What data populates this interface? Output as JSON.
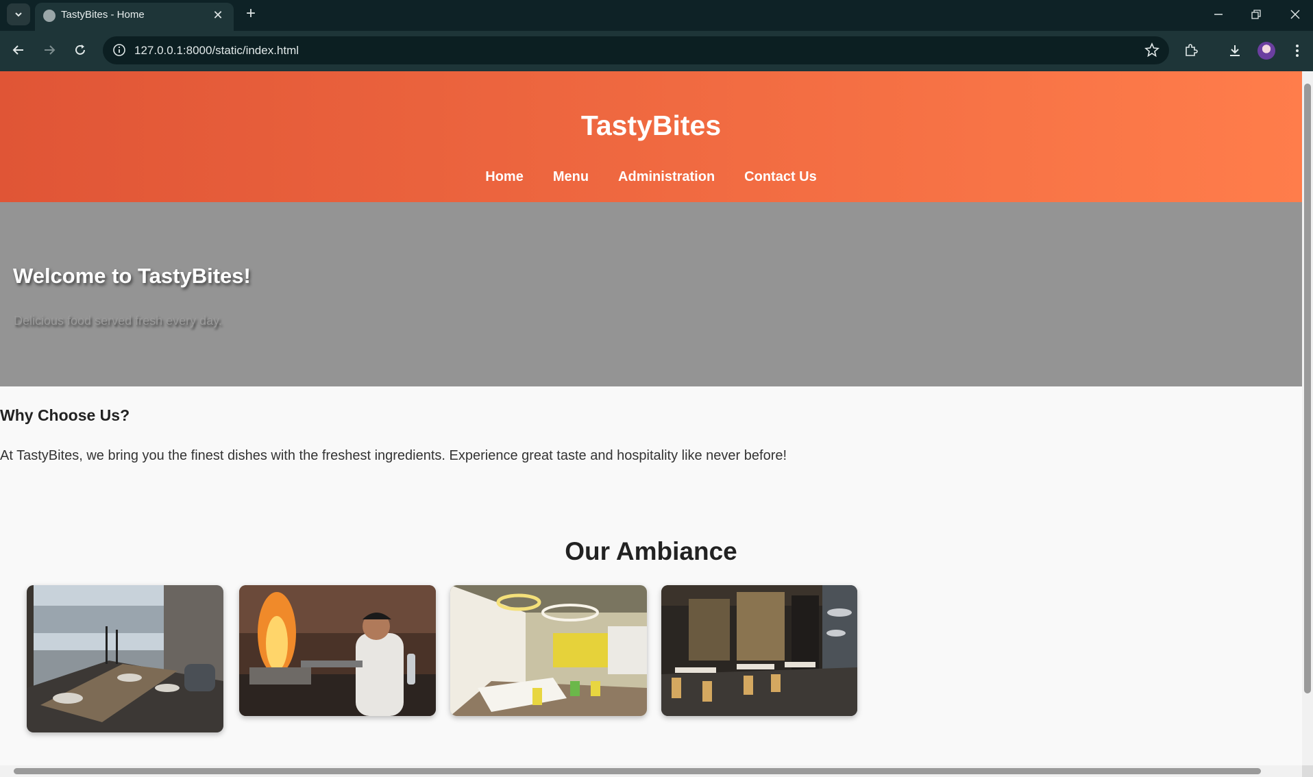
{
  "browser": {
    "tab_title": "TastyBites - Home",
    "url": "127.0.0.1:8000/static/index.html"
  },
  "site": {
    "title": "TastyBites",
    "nav": [
      "Home",
      "Menu",
      "Administration",
      "Contact Us"
    ],
    "hero": {
      "heading": "Welcome to TastyBites!",
      "subheading": "Delicious food served fresh every day."
    },
    "why": {
      "heading": "Why Choose Us?",
      "text": "At TastyBites, we bring you the finest dishes with the freshest ingredients. Experience great taste and hospitality like never before!"
    },
    "ambiance": {
      "heading": "Our Ambiance",
      "images": [
        "dining-table-lake-view",
        "chef-flaming-pan",
        "bright-yellow-dining-room",
        "dark-restaurant-interior"
      ]
    }
  },
  "colors": {
    "header_start": "#e05536",
    "header_end": "#ff7d4b",
    "hero_bg": "#949494",
    "chrome_bg": "#1e3538"
  }
}
